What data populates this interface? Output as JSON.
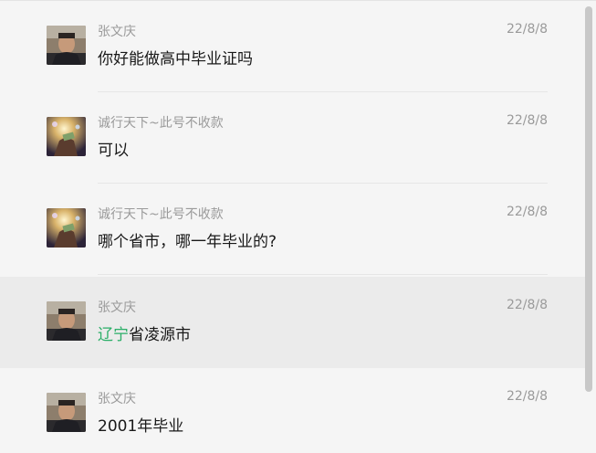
{
  "messages": [
    {
      "sender": "张文庆",
      "time": "22/8/8",
      "text": "你好能做高中毕业证吗",
      "avatar": "man-photo-avatar"
    },
    {
      "sender": "诚行天下~此号不收款",
      "time": "22/8/8",
      "text": "可以",
      "avatar": "hand-money-avatar"
    },
    {
      "sender": "诚行天下~此号不收款",
      "time": "22/8/8",
      "text": "哪个省市，哪一年毕业的?",
      "avatar": "hand-money-avatar"
    },
    {
      "sender": "张文庆",
      "time": "22/8/8",
      "text_highlight": "辽宁",
      "text_rest": "省凌源市",
      "avatar": "man-photo-avatar"
    },
    {
      "sender": "张文庆",
      "time": "22/8/8",
      "text": "2001年毕业",
      "avatar": "man-photo-avatar"
    }
  ],
  "colors": {
    "background": "#f5f5f5",
    "selected_row": "#ebebeb",
    "highlight_text": "#2aae67",
    "meta_text": "#9a9a9a"
  }
}
